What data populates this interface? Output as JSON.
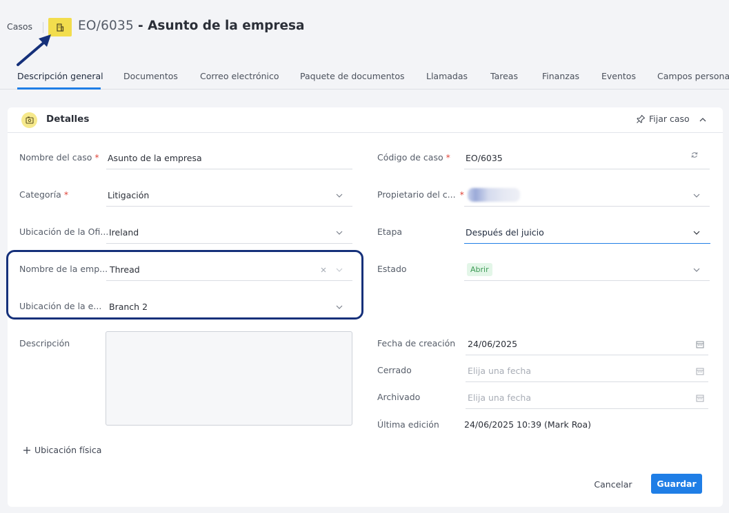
{
  "breadcrumb": {
    "root": "Casos"
  },
  "case": {
    "code": "EO/6035",
    "title": "- Asunto de la empresa",
    "icon": "building-icon"
  },
  "tabs": [
    {
      "label": "Descripción general",
      "active": true
    },
    {
      "label": "Documentos"
    },
    {
      "label": "Correo electrónico"
    },
    {
      "label": "Paquete de documentos"
    },
    {
      "label": "Llamadas"
    },
    {
      "label": "Tareas"
    },
    {
      "label": "Finanzas"
    },
    {
      "label": "Eventos"
    },
    {
      "label": "Campos persona"
    }
  ],
  "section": {
    "title": "Detalles",
    "pin_label": "Fijar caso"
  },
  "form": {
    "case_name": {
      "label": "Nombre del caso",
      "value": "Asunto de la empresa",
      "required": "*"
    },
    "category": {
      "label": "Categoría",
      "value": "Litigación",
      "required": "*"
    },
    "office_location": {
      "label": "Ubicación de la Ofi...",
      "value": "Ireland"
    },
    "company_name": {
      "label": "Nombre de la emp...",
      "value": "Thread"
    },
    "company_location": {
      "label": "Ubicación de la e...",
      "value": "Branch 2"
    },
    "description": {
      "label": "Descripción",
      "value": ""
    },
    "case_code": {
      "label": "Código de caso",
      "value": "EO/6035",
      "required": "*"
    },
    "owner": {
      "label": "Propietario del c...",
      "required": "*"
    },
    "stage": {
      "label": "Etapa",
      "value": "Después del juicio"
    },
    "status": {
      "label": "Estado",
      "value": "Abrir"
    },
    "created": {
      "label": "Fecha de creación",
      "value": "24/06/2025"
    },
    "closed": {
      "label": "Cerrado",
      "placeholder": "Elija una fecha"
    },
    "archived": {
      "label": "Archivado",
      "placeholder": "Elija una fecha"
    },
    "last_edit": {
      "label": "Última edición",
      "value": "24/06/2025 10:39 (Mark Roa)"
    }
  },
  "physical_location": {
    "label": "Ubicación física"
  },
  "actions": {
    "cancel": "Cancelar",
    "save": "Guardar"
  },
  "colors": {
    "accent": "#1f7ee6",
    "case_icon_bg": "#f2dd4d",
    "annotation": "#15307a",
    "status_badge_bg": "#e3f6e8",
    "status_badge_fg": "#3d9a55"
  }
}
